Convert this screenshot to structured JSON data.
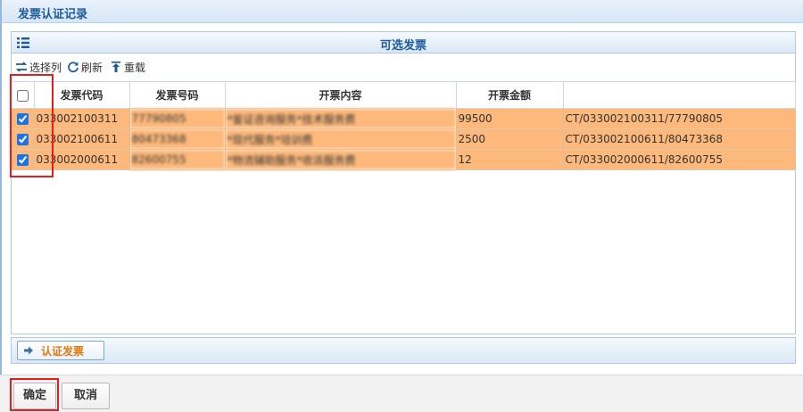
{
  "window": {
    "title": "发票认证记录"
  },
  "panel": {
    "title": "可选发票"
  },
  "toolbar": {
    "select_columns": "选择列",
    "refresh": "刷新",
    "reload": "重载"
  },
  "table": {
    "columns": [
      "",
      "发票代码",
      "发票号码",
      "开票内容",
      "开票金额",
      ""
    ],
    "rows": [
      {
        "checked": true,
        "code": "033002100311",
        "number": "77790805",
        "content": "*鉴证咨询服务*技术服务费",
        "amount": "99500",
        "path": "CT/033002100311/77790805"
      },
      {
        "checked": true,
        "code": "033002100611",
        "number": "80473368",
        "content": "*现代服务*培训费",
        "amount": "2500",
        "path": "CT/033002100611/80473368"
      },
      {
        "checked": true,
        "code": "033002000611",
        "number": "82600755",
        "content": "*物流辅助服务*收派服务费",
        "amount": "12",
        "path": "CT/033002000611/82600755"
      }
    ]
  },
  "actions": {
    "verify": "认证发票"
  },
  "footer": {
    "confirm": "确定",
    "cancel": "取消"
  },
  "colors": {
    "selected_row": "#fdb97b",
    "title_text": "#1d5a9a",
    "highlight_box": "#e02020",
    "verify_text": "#e07a10"
  }
}
